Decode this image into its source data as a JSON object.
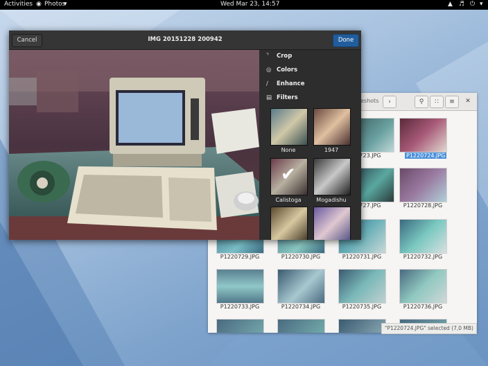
{
  "topbar": {
    "activities": "Activities",
    "app_menu": "Photos",
    "clock": "Wed Mar 23, 14:57"
  },
  "editor": {
    "cancel": "Cancel",
    "title": "IMG 20151228 200942",
    "done": "Done",
    "tools": [
      {
        "icon": "crop-icon",
        "label": "Crop"
      },
      {
        "icon": "colors-icon",
        "label": "Colors"
      },
      {
        "icon": "enhance-icon",
        "label": "Enhance"
      },
      {
        "icon": "filters-icon",
        "label": "Filters"
      }
    ],
    "filters": [
      "None",
      "1947",
      "Calistoga",
      "Mogadishu"
    ],
    "selected_filter": "Calistoga"
  },
  "files": {
    "breadcrumb": "eshots",
    "rows": [
      [
        "723.JPG",
        "P1220724.JPG"
      ],
      [
        "727.JPG",
        "P1220728.JPG"
      ],
      [
        "P1220729.JPG",
        "P1220730.JPG",
        "P1220731.JPG",
        "P1220732.JPG"
      ],
      [
        "P1220733.JPG",
        "P1220734.JPG",
        "P1220735.JPG",
        "P1220736.JPG"
      ]
    ],
    "selected": "P1220724.JPG",
    "status": "\"P1220724.JPG\" selected  (7,0 MB)"
  }
}
